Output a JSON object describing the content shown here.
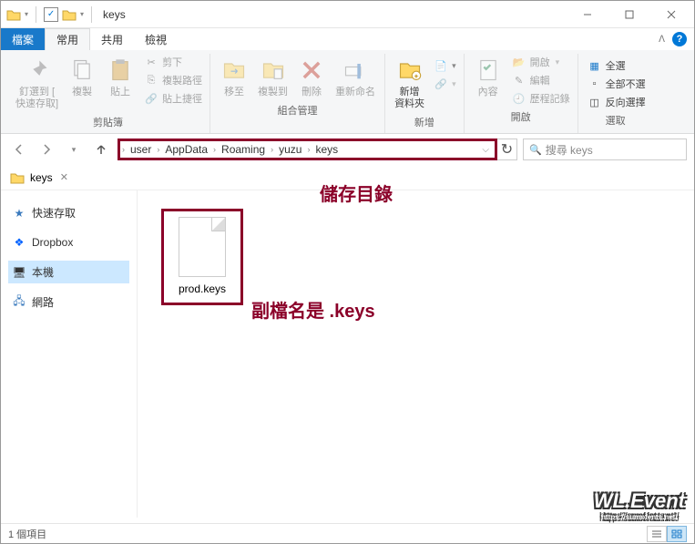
{
  "titlebar": {
    "title": "keys"
  },
  "tabs": {
    "file": "檔案",
    "home": "常用",
    "share": "共用",
    "view": "檢視"
  },
  "ribbon": {
    "clipboard": {
      "pin": "釘選到 [\n快速存取]",
      "copy": "複製",
      "paste": "貼上",
      "cut": "剪下",
      "copypath": "複製路徑",
      "pasteshortcut": "貼上捷徑",
      "label": "剪貼簿"
    },
    "organize": {
      "moveto": "移至",
      "copyto": "複製到",
      "delete": "刪除",
      "rename": "重新命名",
      "label": "組合管理"
    },
    "new": {
      "newfolder": "新增\n資料夾",
      "label": "新增"
    },
    "open": {
      "properties": "內容",
      "open": "開啟",
      "edit": "編輯",
      "history": "歷程記錄",
      "label": "開啟"
    },
    "select": {
      "selectall": "全選",
      "selectnone": "全部不選",
      "invert": "反向選擇",
      "label": "選取"
    }
  },
  "breadcrumb": [
    "user",
    "AppData",
    "Roaming",
    "yuzu",
    "keys"
  ],
  "search": {
    "placeholder": "搜尋 keys"
  },
  "tree": {
    "current": "keys"
  },
  "sidebar": {
    "items": [
      {
        "label": "快速存取",
        "icon": "star"
      },
      {
        "label": "Dropbox",
        "icon": "dropbox"
      },
      {
        "label": "本機",
        "icon": "pc",
        "selected": true
      },
      {
        "label": "網路",
        "icon": "network"
      }
    ]
  },
  "files": [
    {
      "name": "prod.keys"
    }
  ],
  "annotations": {
    "storage_dir": "儲存目錄",
    "extension_note": "副檔名是 .keys"
  },
  "status": {
    "count": "1 個項目"
  },
  "watermark": {
    "main": "WL.Event",
    "sub": "https://sumofents.net/"
  }
}
